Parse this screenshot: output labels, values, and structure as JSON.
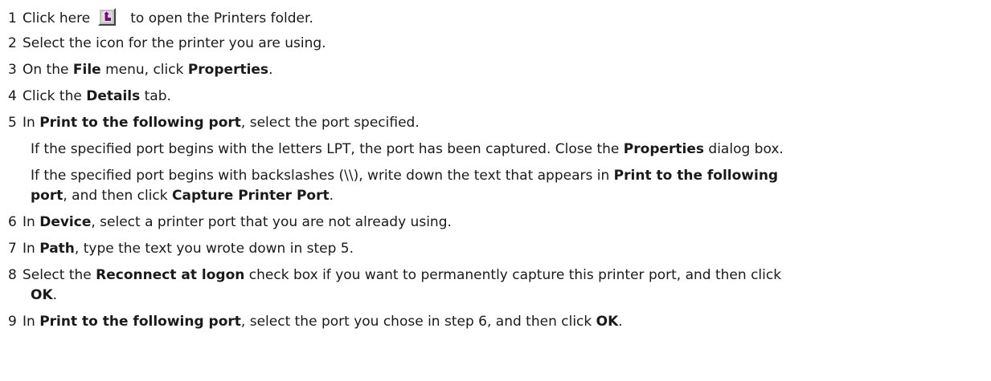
{
  "steps": [
    {
      "num": "1",
      "before": "Click here",
      "after": "to open the Printers folder."
    },
    {
      "num": "2",
      "text": "Select the icon for the printer you are using."
    },
    {
      "num": "3",
      "t1": "On the ",
      "b1": "File",
      "t2": " menu, click ",
      "b2": "Properties",
      "t3": "."
    },
    {
      "num": "4",
      "t1": "Click the ",
      "b1": "Details",
      "t2": " tab."
    },
    {
      "num": "5",
      "t1": "In ",
      "b1": "Print to the following port",
      "t2": ", select the port specified."
    },
    {
      "num": "6",
      "t1": "In ",
      "b1": "Device",
      "t2": ", select a printer port that you are not already using."
    },
    {
      "num": "7",
      "t1": "In ",
      "b1": "Path",
      "t2": ", type the text you wrote down in step 5."
    },
    {
      "num": "8",
      "t1": "Select the ",
      "b1": "Reconnect at logon",
      "t2": " check box if you want to permanently capture this printer port, and then click",
      "b2": "OK",
      "t3": "."
    },
    {
      "num": "9",
      "t1": "In ",
      "b1": "Print to the following port",
      "t2": ", select the port you chose in step 6, and then click ",
      "b2": "OK",
      "t3": "."
    }
  ],
  "notes": {
    "lpt": {
      "t1": "If the specified port begins with the letters LPT, the port has been captured. Close the ",
      "b1": "Properties",
      "t2": " dialog box."
    },
    "backslash": {
      "t1": "If the specified port begins with backslashes (\\\\), write down the text that appears in ",
      "b1": "Print to the following",
      "b2": "port",
      "t2": ", and then click ",
      "b3": "Capture Printer Port",
      "t3": "."
    }
  },
  "icons": {
    "shortcut": "shortcut-arrow-icon"
  },
  "colors": {
    "icon_face": "#c0c0c0",
    "icon_accent": "#800080"
  }
}
